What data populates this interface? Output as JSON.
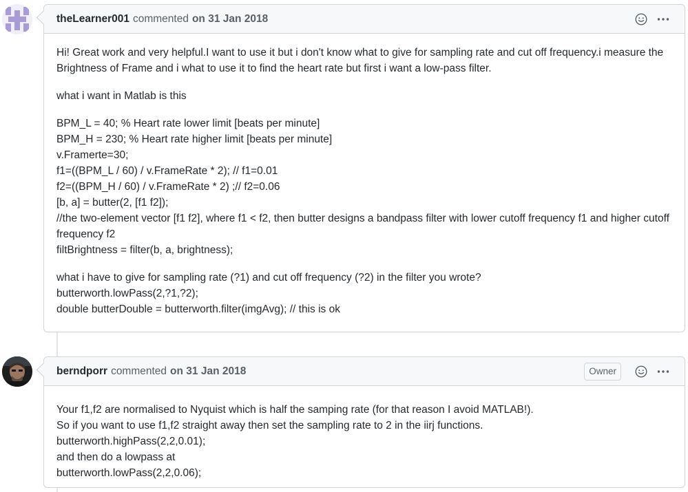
{
  "comments": [
    {
      "author": "theLearner001",
      "verb": "commented",
      "date": "on 31 Jan 2018",
      "badge": "",
      "paragraphs": [
        [
          "Hi! Great work and very helpful.I want to use it but i don't know what to give for sampling rate and cut off frequency.i measure the Brightness of Frame and i what to use it to find the heart rate but first i want a low-pass filter."
        ],
        [
          "what i want in Matlab is this"
        ],
        [
          "BPM_L = 40; % Heart rate lower limit [beats per minute]",
          "BPM_H = 230; % Heart rate higher limit [beats per minute]",
          "v.Framerte=30;",
          "f1=((BPM_L / 60) / v.FrameRate * 2); // f1=0.01",
          "f2=((BPM_H / 60) / v.FrameRate * 2) ;// f2=0.06",
          "[b, a] = butter(2, [f1 f2]);",
          "//the two-element vector [f1 f2], where f1 < f2, then butter designs a bandpass filter with lower cutoff frequency f1 and higher cutoff frequency f2",
          "filtBrightness = filter(b, a, brightness);"
        ],
        [
          "what i have to give for sampling rate (?1) and cut off frequency (?2) in the filter you wrote?",
          "butterworth.lowPass(2,?1,?2);",
          "double butterDouble = butterworth.filter(imgAvg); // this is ok"
        ]
      ]
    },
    {
      "author": "berndporr",
      "verb": "commented",
      "date": "on 31 Jan 2018",
      "badge": "Owner",
      "paragraphs": [
        [
          "Your f1,f2 are normalised to Nyquist which is half the samping rate (for that reason I avoid MATLAB!).",
          "So if you want to use f1,f2 straight away then set the sampling rate to 2 in the iirj functions.",
          "butterworth.highPass(2,2,0.01);",
          "and then do a lowpass at",
          "butterworth.lowPass(2,2,0.06);"
        ]
      ]
    }
  ],
  "icons": {
    "reaction": "smiley-icon",
    "menu": "kebab-horizontal-icon"
  },
  "colors": {
    "header_bg": "#f6f8fa",
    "border": "#d1d5da",
    "text": "#24292e",
    "muted": "#586069"
  }
}
